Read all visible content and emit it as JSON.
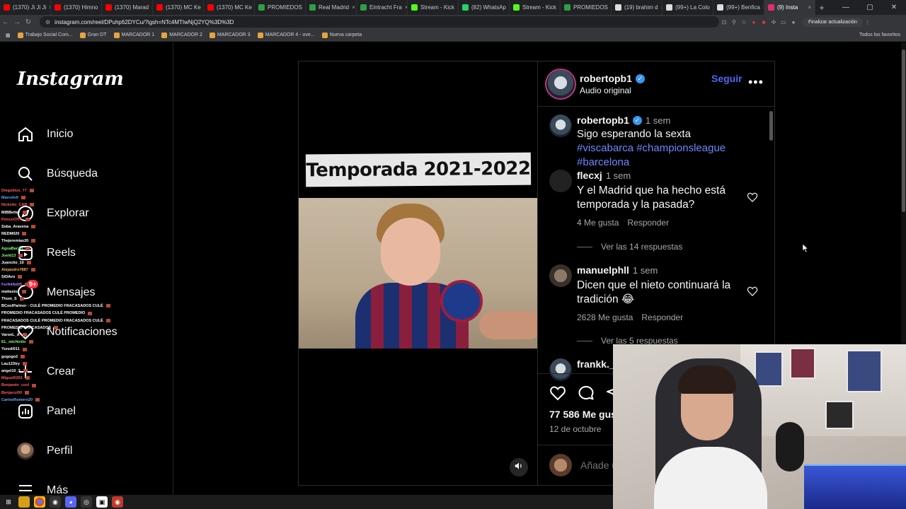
{
  "browser": {
    "tabs": [
      {
        "label": "(1370) Ji Ji Ji",
        "color": "#ff0000"
      },
      {
        "label": "(1370) Himno",
        "color": "#ff0000"
      },
      {
        "label": "(1370) Marad",
        "color": "#ff0000"
      },
      {
        "label": "(1370) MC Ke",
        "color": "#ff0000"
      },
      {
        "label": "(1370) MC Ke",
        "color": "#ff0000"
      },
      {
        "label": "PROMIEDOS",
        "color": "#2ea043"
      },
      {
        "label": "Real Madrid",
        "color": "#2ea043"
      },
      {
        "label": "Eintracht Fra",
        "color": "#2ea043"
      },
      {
        "label": "Stream - Kick",
        "color": "#53fc18"
      },
      {
        "label": "(82) WhatsAp",
        "color": "#25d366"
      },
      {
        "label": "Stream - Kick",
        "color": "#53fc18"
      },
      {
        "label": "PROMIEDOS",
        "color": "#2ea043"
      },
      {
        "label": "(19) brahim d",
        "color": "#dddddd"
      },
      {
        "label": "(99+) La Colo",
        "color": "#dddddd"
      },
      {
        "label": "(99+) Benfica",
        "color": "#dddddd"
      },
      {
        "label": "(9) Insta",
        "color": "#e1306c"
      }
    ],
    "url": "instagram.com/reel/DPuhp62DYCu/?igsh=NTc4MTIwNjQ2YQ%3D%3D",
    "update_label": "Finalizar actualización",
    "bookmarks": [
      "Trabajo Social Com...",
      "Gran DT",
      "MARCADOR 1",
      "MARCADOR 2",
      "MARCADOR 3",
      "MARCADOR 4 - ove...",
      "Nueva carpeta"
    ],
    "all_bookmarks": "Todos los favoritos"
  },
  "sidebar": {
    "logo": "Instagram",
    "items": [
      {
        "label": "Inicio",
        "icon": "home-icon"
      },
      {
        "label": "Búsqueda",
        "icon": "search-icon"
      },
      {
        "label": "Explorar",
        "icon": "compass-icon"
      },
      {
        "label": "Reels",
        "icon": "reels-icon"
      },
      {
        "label": "Mensajes",
        "icon": "messenger-icon"
      },
      {
        "label": "Notificaciones",
        "icon": "heart-icon"
      },
      {
        "label": "Crear",
        "icon": "plus-icon"
      },
      {
        "label": "Panel",
        "icon": "chart-icon"
      },
      {
        "label": "Perfil",
        "icon": "avatar"
      },
      {
        "label": "Más",
        "icon": "menu-icon"
      }
    ],
    "messages_badge": "9+"
  },
  "chat": [
    {
      "user": "Diegolitos_77",
      "color": "#ff5c5c"
    },
    {
      "user": "Marcelo9",
      "color": "#6aa8ff"
    },
    {
      "user": "Nicksito_CAB",
      "color": "#ff5c5c"
    },
    {
      "user": "MiBBetter",
      "color": "#ffffff"
    },
    {
      "user": "PrinceOfTh",
      "color": "#ff5c5c"
    },
    {
      "user": "Soba_Aravena",
      "color": "#ffffff"
    },
    {
      "user": "REDM020",
      "color": "#ffffff"
    },
    {
      "user": "Thejeremias20",
      "color": "#ffffff"
    },
    {
      "user": "AguaBacan",
      "color": "#7cff7c"
    },
    {
      "user": "Joeld13",
      "color": "#7cff7c"
    },
    {
      "user": "Juancito_10",
      "color": "#ffffff"
    },
    {
      "user": "Alejandro7887",
      "color": "#ffb347"
    },
    {
      "user": "SiDAvo",
      "color": "#ffffff"
    },
    {
      "user": "FerN4Nd05",
      "color": "#b07cff"
    },
    {
      "user": "matiastor",
      "color": "#ffffff"
    },
    {
      "user": "Thom_S",
      "color": "#ffffff"
    },
    {
      "user": "BCoolPartner : CULÉ PROMEDIO FRACASADOS CULÉ",
      "color": "#ffffff"
    },
    {
      "user": "PROMEDIO FRACASADOS CULÉ PROMEDIO",
      "color": "#ffffff"
    },
    {
      "user": "FRACASADOS CULÉ PROMEDIO FRACASADOS CULÉ",
      "color": "#ffffff"
    },
    {
      "user": "PROMEDIO FRACASADOS",
      "color": "#ffffff"
    },
    {
      "user": "VaronL_A",
      "color": "#ffffff"
    },
    {
      "user": "EL_michinito",
      "color": "#7cff7c"
    },
    {
      "user": "Yuredi011",
      "color": "#ffffff"
    },
    {
      "user": "gogogo2",
      "color": "#ffffff"
    },
    {
      "user": "Lau123try",
      "color": "#ffffff"
    },
    {
      "user": "angel10_3",
      "color": "#ffffff"
    },
    {
      "user": "Miguel0202",
      "color": "#ff5c5c"
    },
    {
      "user": "Benjamin_cool",
      "color": "#ff5c5c"
    },
    {
      "user": "Benjacol00",
      "color": "#ff5c5c"
    },
    {
      "user": "CarlosRomero20",
      "color": "#6aa8ff"
    }
  ],
  "video": {
    "title": "Temporada 2021-2022"
  },
  "post": {
    "username": "robertopb1",
    "subtitle": "Audio original",
    "follow_label": "Seguir",
    "more": "•••",
    "caption_user": "robertopb1",
    "caption_time": "1 sem",
    "caption_text": "Sigo esperando la sexta ",
    "caption_tags": [
      "#viscabarca",
      "#championsleague",
      "#barcelona"
    ],
    "likes": "77 586 Me gus",
    "date": "12 de octubre",
    "comment_placeholder": "Añade u"
  },
  "comments": [
    {
      "user": "flecxj",
      "time": "1 sem",
      "text": "Y el Madrid que ha hecho está temporada y la pasada?",
      "likes": "4 Me gusta",
      "reply": "Responder",
      "view_replies": "Ver las 14 respuestas"
    },
    {
      "user": "manuelphll",
      "time": "1 sem",
      "text": "Dicen que el nieto continuará la tradición 😂",
      "likes": "2628 Me gusta",
      "reply": "Responder",
      "view_replies": "Ver las 5 respuestas"
    },
    {
      "user": "frankk._",
      "time": "",
      "text": ""
    }
  ]
}
